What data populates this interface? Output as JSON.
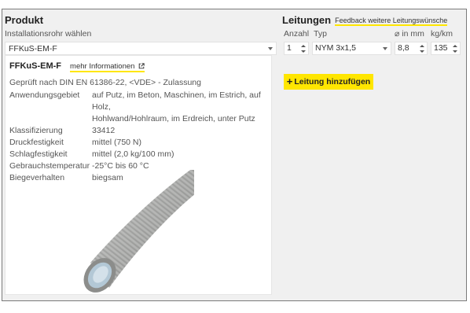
{
  "produkt": {
    "title": "Produkt",
    "select_label": "Installationsrohr wählen",
    "select_value": "FFKuS-EM-F"
  },
  "card": {
    "name": "FFKuS-EM-F",
    "more_link": "mehr Informationen",
    "approval": "Geprüft nach DIN EN 61386-22, <VDE> - Zulassung",
    "properties": [
      {
        "key": "Anwendungsgebiet",
        "value": "auf Putz, im Beton, Maschinen, im Estrich, auf Holz,\nHohlwand/Hohlraum, im Erdreich, unter Putz"
      },
      {
        "key": "Klassifizierung",
        "value": "33412"
      },
      {
        "key": "Druckfestigkeit",
        "value": "mittel (750 N)"
      },
      {
        "key": "Schlagfestigkeit",
        "value": "mittel (2,0 kg/100 mm)"
      },
      {
        "key": "Gebrauchstemperatur",
        "value": "-25°C bis 60 °C"
      },
      {
        "key": "Biegeverhalten",
        "value": "biegsam"
      }
    ]
  },
  "leitungen": {
    "title": "Leitungen",
    "feedback_link": "Feedback weitere Leitungswünsche",
    "columns": {
      "anzahl": "Anzahl",
      "typ": "Typ",
      "diameter": "⌀ in mm",
      "weight": "kg/km"
    },
    "row": {
      "anzahl": "1",
      "typ": "NYM 3x1,5",
      "diameter": "8,8",
      "weight": "135"
    },
    "add_button": "Leitung hinzufügen"
  },
  "colors": {
    "accent": "#ffe600",
    "panel_bg": "#f0f0f0",
    "border": "#7a7a7a"
  },
  "icons": {
    "external_link": "external-link-icon",
    "dropdown": "chevron-down-icon",
    "spinner": "spinner-arrows-icon",
    "add": "plus-icon"
  }
}
